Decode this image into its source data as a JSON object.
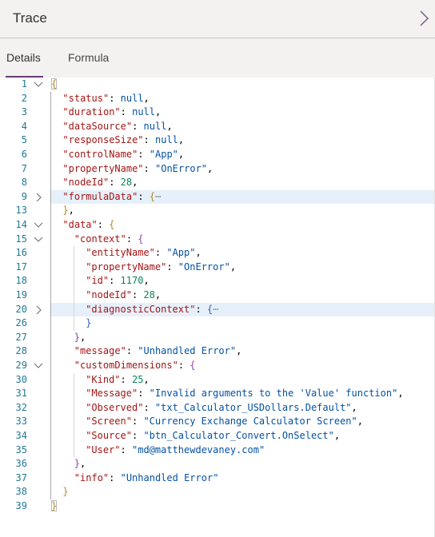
{
  "header": {
    "title": "Trace",
    "collapse_icon": "chevron-right-icon"
  },
  "tabs": [
    {
      "label": "Details",
      "active": true
    },
    {
      "label": "Formula",
      "active": false
    }
  ],
  "editor": {
    "lines": [
      {
        "num": "1",
        "fold": "expanded",
        "indent": 0,
        "tokens": [
          [
            "b0",
            "{"
          ]
        ]
      },
      {
        "num": "2",
        "indent": 1,
        "tokens": [
          [
            "k",
            "\"status\""
          ],
          [
            "p",
            ": "
          ],
          [
            "s",
            "null"
          ],
          [
            "p",
            ","
          ]
        ]
      },
      {
        "num": "3",
        "indent": 1,
        "tokens": [
          [
            "k",
            "\"duration\""
          ],
          [
            "p",
            ": "
          ],
          [
            "s",
            "null"
          ],
          [
            "p",
            ","
          ]
        ]
      },
      {
        "num": "4",
        "indent": 1,
        "tokens": [
          [
            "k",
            "\"dataSource\""
          ],
          [
            "p",
            ": "
          ],
          [
            "s",
            "null"
          ],
          [
            "p",
            ","
          ]
        ]
      },
      {
        "num": "5",
        "indent": 1,
        "tokens": [
          [
            "k",
            "\"responseSize\""
          ],
          [
            "p",
            ": "
          ],
          [
            "s",
            "null"
          ],
          [
            "p",
            ","
          ]
        ]
      },
      {
        "num": "6",
        "indent": 1,
        "tokens": [
          [
            "k",
            "\"controlName\""
          ],
          [
            "p",
            ": "
          ],
          [
            "s",
            "\"App\""
          ],
          [
            "p",
            ","
          ]
        ]
      },
      {
        "num": "7",
        "indent": 1,
        "tokens": [
          [
            "k",
            "\"propertyName\""
          ],
          [
            "p",
            ": "
          ],
          [
            "s",
            "\"OnError\""
          ],
          [
            "p",
            ","
          ]
        ]
      },
      {
        "num": "8",
        "indent": 1,
        "tokens": [
          [
            "k",
            "\"nodeId\""
          ],
          [
            "p",
            ": "
          ],
          [
            "n",
            "28"
          ],
          [
            "p",
            ","
          ]
        ]
      },
      {
        "num": "9",
        "fold": "collapsed",
        "highlight": true,
        "indent": 1,
        "tokens": [
          [
            "k",
            "\"formulaData\""
          ],
          [
            "p",
            ": "
          ],
          [
            "b1",
            "{"
          ],
          [
            "ell",
            "⋯"
          ]
        ]
      },
      {
        "num": "13",
        "indent": 1,
        "tokens": [
          [
            "b1",
            "}"
          ],
          [
            "p",
            ","
          ]
        ]
      },
      {
        "num": "14",
        "fold": "expanded",
        "indent": 1,
        "tokens": [
          [
            "k",
            "\"data\""
          ],
          [
            "p",
            ": "
          ],
          [
            "b1",
            "{"
          ]
        ]
      },
      {
        "num": "15",
        "fold": "expanded",
        "indent": 2,
        "tokens": [
          [
            "k",
            "\"context\""
          ],
          [
            "p",
            ": "
          ],
          [
            "b2",
            "{"
          ]
        ]
      },
      {
        "num": "16",
        "indent": 3,
        "tokens": [
          [
            "k",
            "\"entityName\""
          ],
          [
            "p",
            ": "
          ],
          [
            "s",
            "\"App\""
          ],
          [
            "p",
            ","
          ]
        ]
      },
      {
        "num": "17",
        "indent": 3,
        "tokens": [
          [
            "k",
            "\"propertyName\""
          ],
          [
            "p",
            ": "
          ],
          [
            "s",
            "\"OnError\""
          ],
          [
            "p",
            ","
          ]
        ]
      },
      {
        "num": "18",
        "indent": 3,
        "tokens": [
          [
            "k",
            "\"id\""
          ],
          [
            "p",
            ": "
          ],
          [
            "n",
            "1170"
          ],
          [
            "p",
            ","
          ]
        ]
      },
      {
        "num": "19",
        "indent": 3,
        "tokens": [
          [
            "k",
            "\"nodeId\""
          ],
          [
            "p",
            ": "
          ],
          [
            "n",
            "28"
          ],
          [
            "p",
            ","
          ]
        ]
      },
      {
        "num": "20",
        "fold": "collapsed",
        "highlight": true,
        "indent": 3,
        "tokens": [
          [
            "k",
            "\"diagnosticContext\""
          ],
          [
            "p",
            ": "
          ],
          [
            "b3",
            "{"
          ],
          [
            "ell",
            "⋯"
          ]
        ]
      },
      {
        "num": "26",
        "indent": 3,
        "tokens": [
          [
            "b3",
            "}"
          ]
        ]
      },
      {
        "num": "27",
        "indent": 2,
        "tokens": [
          [
            "b2",
            "}"
          ],
          [
            "p",
            ","
          ]
        ]
      },
      {
        "num": "28",
        "indent": 2,
        "tokens": [
          [
            "k",
            "\"message\""
          ],
          [
            "p",
            ": "
          ],
          [
            "s",
            "\"Unhandled Error\""
          ],
          [
            "p",
            ","
          ]
        ]
      },
      {
        "num": "29",
        "fold": "expanded",
        "indent": 2,
        "tokens": [
          [
            "k",
            "\"customDimensions\""
          ],
          [
            "p",
            ": "
          ],
          [
            "b2",
            "{"
          ]
        ]
      },
      {
        "num": "30",
        "indent": 3,
        "tokens": [
          [
            "k",
            "\"Kind\""
          ],
          [
            "p",
            ": "
          ],
          [
            "n",
            "25"
          ],
          [
            "p",
            ","
          ]
        ]
      },
      {
        "num": "31",
        "indent": 3,
        "tokens": [
          [
            "k",
            "\"Message\""
          ],
          [
            "p",
            ": "
          ],
          [
            "s",
            "\"Invalid arguments to the 'Value' function\""
          ],
          [
            "p",
            ","
          ]
        ]
      },
      {
        "num": "32",
        "indent": 3,
        "tokens": [
          [
            "k",
            "\"Observed\""
          ],
          [
            "p",
            ": "
          ],
          [
            "s",
            "\"txt_Calculator_USDollars.Default\""
          ],
          [
            "p",
            ","
          ]
        ]
      },
      {
        "num": "33",
        "indent": 3,
        "tokens": [
          [
            "k",
            "\"Screen\""
          ],
          [
            "p",
            ": "
          ],
          [
            "s",
            "\"Currency Exchange Calculator Screen\""
          ],
          [
            "p",
            ","
          ]
        ]
      },
      {
        "num": "34",
        "indent": 3,
        "tokens": [
          [
            "k",
            "\"Source\""
          ],
          [
            "p",
            ": "
          ],
          [
            "s",
            "\"btn_Calculator_Convert.OnSelect\""
          ],
          [
            "p",
            ","
          ]
        ]
      },
      {
        "num": "35",
        "indent": 3,
        "tokens": [
          [
            "k",
            "\"User\""
          ],
          [
            "p",
            ": "
          ],
          [
            "s",
            "\"md@matthewdevaney.com\""
          ]
        ]
      },
      {
        "num": "36",
        "indent": 2,
        "tokens": [
          [
            "b2",
            "}"
          ],
          [
            "p",
            ","
          ]
        ]
      },
      {
        "num": "37",
        "indent": 2,
        "tokens": [
          [
            "k",
            "\"info\""
          ],
          [
            "p",
            ": "
          ],
          [
            "s",
            "\"Unhandled Error\""
          ]
        ]
      },
      {
        "num": "38",
        "indent": 1,
        "tokens": [
          [
            "b1",
            "}"
          ]
        ]
      },
      {
        "num": "39",
        "indent": 0,
        "tokens": [
          [
            "b0",
            "}"
          ]
        ]
      }
    ]
  }
}
